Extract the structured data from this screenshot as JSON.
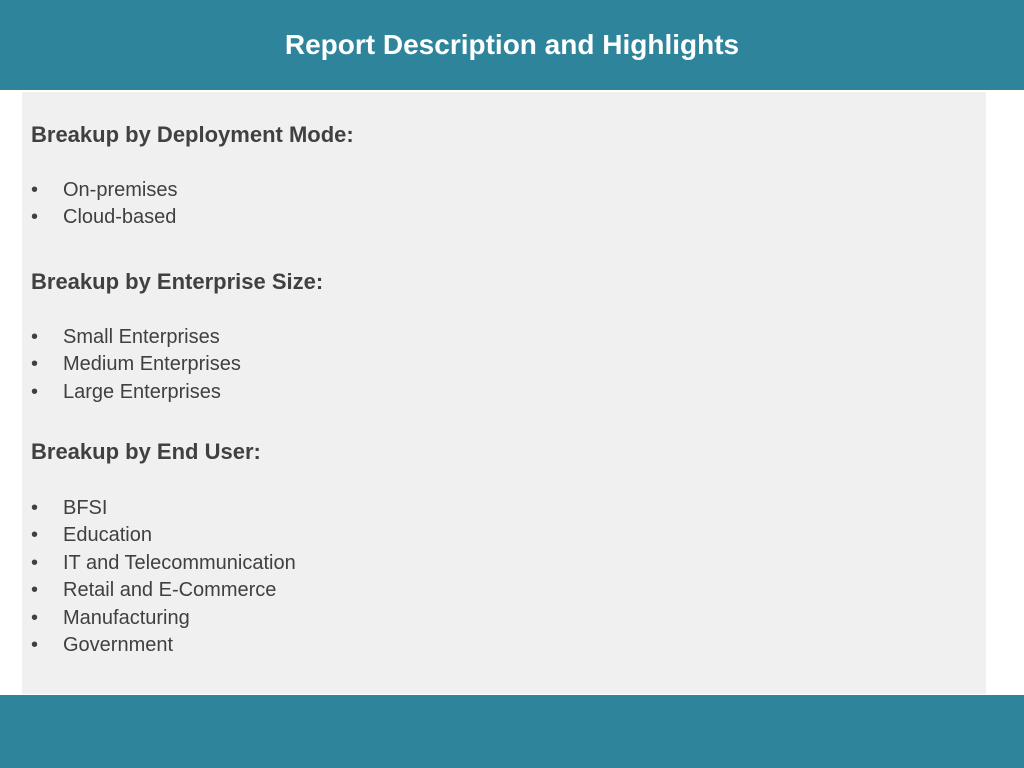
{
  "slide": {
    "title": "Report Description and Highlights"
  },
  "sections": [
    {
      "heading": "Breakup by Deployment Mode:",
      "items": [
        "On-premises",
        "Cloud-based"
      ]
    },
    {
      "heading": "Breakup by Enterprise Size:",
      "items": [
        "Small Enterprises",
        "Medium Enterprises",
        "Large Enterprises"
      ]
    },
    {
      "heading": "Breakup by End User:",
      "items": [
        "BFSI",
        "Education",
        "IT and Telecommunication",
        "Retail and E-Commerce",
        "Manufacturing",
        "Government"
      ]
    }
  ],
  "bullet_glyph": "•",
  "colors": {
    "band": "#2e849b",
    "panel": "#f0f0f0",
    "text": "#404040",
    "title_text": "#ffffff"
  }
}
